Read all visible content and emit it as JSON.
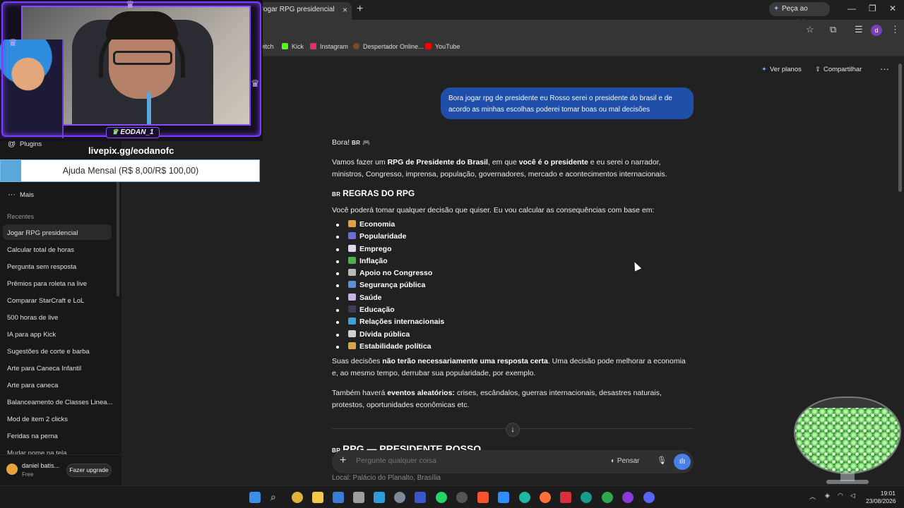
{
  "browser": {
    "tab_title": "Jogar RPG presidencial",
    "tab_close": "×",
    "new_tab": "+",
    "gemini_button": "Peça ao Gemini",
    "bookmarks": [
      {
        "label": "Twitch",
        "color": "#9146ff"
      },
      {
        "label": "Kick",
        "color": "#53fc18"
      },
      {
        "label": "Instagram",
        "color": "#e1306c"
      },
      {
        "label": "Despertador Online...",
        "color": "#7a4a2a"
      },
      {
        "label": "YouTube",
        "color": "#ff0000"
      }
    ],
    "profile_initial": "d"
  },
  "overlay": {
    "streamer_name": "EODAN_1",
    "pix_url": "livepix.gg/eodanofc",
    "goal_text": "Ajuda Mensal (R$ 8,00/R$ 100,00)",
    "goal_progress": 0.08
  },
  "sidebar": {
    "top_items": [
      {
        "label": "Plugins",
        "icon": "at-icon"
      },
      {
        "label": "Mais",
        "icon": "more-icon"
      }
    ],
    "section_title": "Recentes",
    "recent": [
      "Jogar RPG presidencial",
      "Calcular total de horas",
      "Pergunta sem resposta",
      "Prêmios para roleta na live",
      "Comparar StarCraft e LoL",
      "500 horas de live",
      "IA para app Kick",
      "Sugestões de corte e barba",
      "Arte para Caneca Infantil",
      "Arte para caneca",
      "Balanceamento de Classes Linea...",
      "Mod de item 2 clicks",
      "Feridas na perna",
      "Mudar nome na tela"
    ],
    "user": {
      "name": "daniel batis...",
      "plan": "Free",
      "upgrade_label": "Fazer upgrade"
    }
  },
  "header": {
    "plans_label": "Ver planos",
    "share_label": "Compartilhar",
    "more": "···"
  },
  "chat": {
    "user_message": "Bora jogar rpg de presidente eu Rosso serei o presidente do brasil e de acordo as minhas escolhas poderei tomar boas ou mal decisões",
    "greeting": "Bora! ",
    "greeting_flag": "BR",
    "greeting_emoji": "🎮",
    "intro": {
      "p1": "Vamos fazer um ",
      "b1": "RPG de Presidente do Brasil",
      "p2": ", em que ",
      "b2": "você é o presidente",
      "p3": " e eu serei o narrador, ministros, Congresso, imprensa, população, governadores, mercado e acontecimentos internacionais."
    },
    "rules_flag": "BR",
    "rules_title": "REGRAS DO RPG",
    "rules_intro": "Você poderá tomar qualquer decisão que quiser. Eu vou calcular as consequências com base em:",
    "rules": [
      {
        "label": "Economia",
        "color": "#e0a23a"
      },
      {
        "label": "Popularidade",
        "color": "#6a6fd6"
      },
      {
        "label": "Emprego",
        "color": "#d9d9e8"
      },
      {
        "label": "Inflação",
        "color": "#4caf50"
      },
      {
        "label": "Apoio no Congresso",
        "color": "#b9b9b9"
      },
      {
        "label": "Segurança pública",
        "color": "#5d8fe0"
      },
      {
        "label": "Saúde",
        "color": "#c7b3e8"
      },
      {
        "label": "Educação",
        "color": "#3d3d55"
      },
      {
        "label": "Relações internacionais",
        "color": "#3fa0d8"
      },
      {
        "label": "Dívida pública",
        "color": "#d0d0d0"
      },
      {
        "label": "Estabilidade política",
        "color": "#d9a441"
      }
    ],
    "decisions": {
      "p1": "Suas decisões ",
      "b1": "não terão necessariamente uma resposta certa",
      "p2": ". Uma decisão pode melhorar a economia e, ao mesmo tempo, derrubar sua popularidade, por exemplo."
    },
    "events": {
      "p1": "Também haverá ",
      "b1": "eventos aleatórios:",
      "p2": " crises, escândalos, guerras internacionais, desastres naturais, protestos, oportunidades econômicas etc."
    },
    "section2_flag": "BR",
    "section2_title": "RPG — PRESIDENTE ROSSO",
    "local": "Local: Palácio do Planalto, Brasília"
  },
  "composer": {
    "placeholder": "Pergunte qualquer coisa",
    "think_label": "Pensar"
  },
  "taskbar": {
    "time": "19:01",
    "date": "23/08/2026"
  },
  "colors": {
    "accent_blue": "#1f4fa8",
    "voice_button": "#4a7ee8",
    "overlay_purple": "#7c3cff"
  }
}
